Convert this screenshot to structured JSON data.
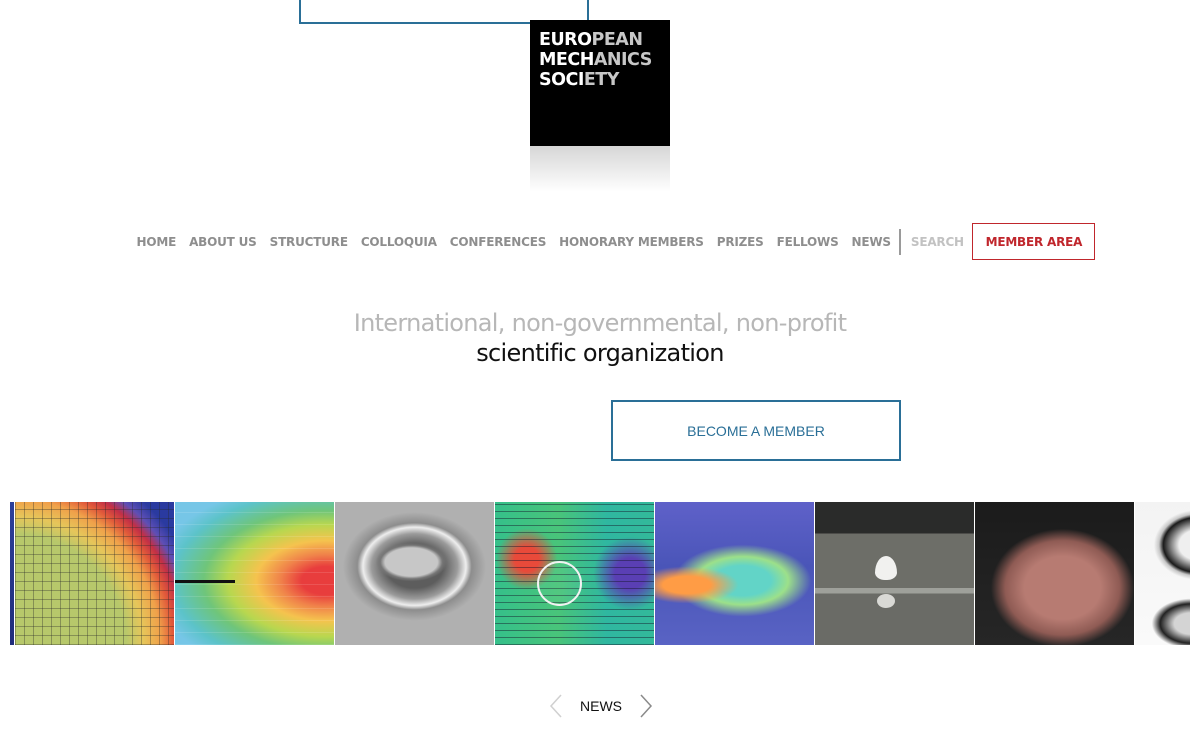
{
  "logo": {
    "lines": [
      {
        "a": "EURO",
        "b": "PEAN"
      },
      {
        "a": "MECH",
        "b": "ANICS"
      },
      {
        "a": "SOCI",
        "b": "ETY"
      }
    ]
  },
  "nav": {
    "items": [
      "HOME",
      "ABOUT US",
      "STRUCTURE",
      "COLLOQUIA",
      "CONFERENCES",
      "HONORARY MEMBERS",
      "PRIZES",
      "FELLOWS",
      "NEWS"
    ],
    "search_label": "SEARCH",
    "member_area_label": "MEMBER AREA"
  },
  "hero": {
    "tagline_line1": "International, non-governmental, non-profit",
    "tagline_line2": "scientific organization",
    "cta_label": "BECOME A MEMBER"
  },
  "gallery": {
    "images": [
      "fem-mesh-corner",
      "crack-field-map",
      "sem-grain",
      "vector-flow-cylinder",
      "turbulence-field",
      "droplet-on-surface",
      "particle-cluster",
      "liquid-bridge"
    ]
  },
  "news": {
    "label": "NEWS",
    "prev_icon": "chevron-left-icon",
    "next_icon": "chevron-right-icon"
  },
  "colors": {
    "accent_blue": "#2a6f97",
    "accent_red": "#c0262c",
    "nav_gray": "#8e8e8e"
  }
}
